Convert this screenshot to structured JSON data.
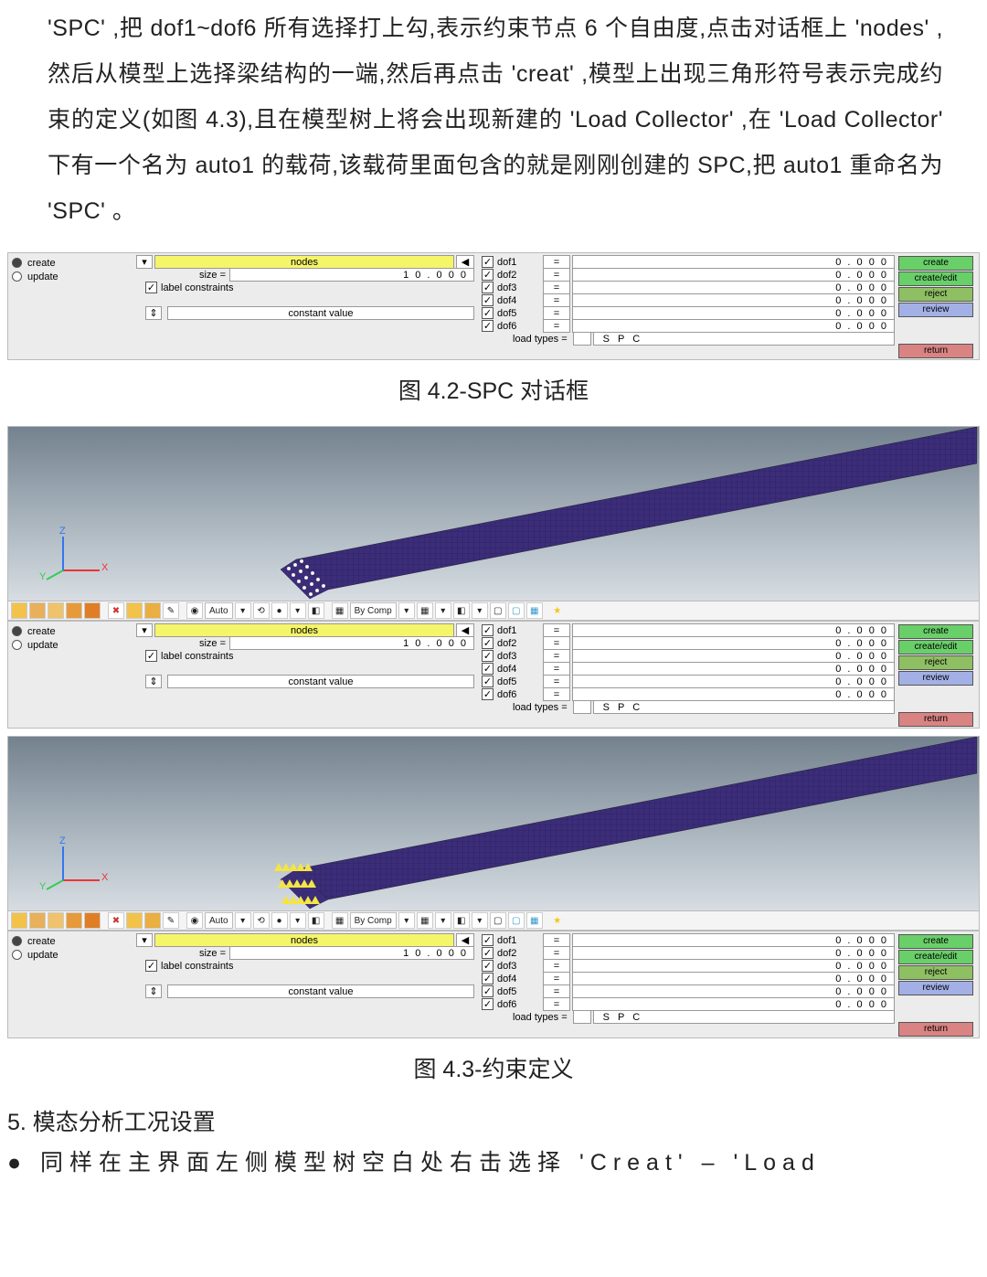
{
  "body_paragraph": "'SPC' ,把 dof1~dof6 所有选择打上勾,表示约束节点 6 个自由度,点击对话框上 'nodes' ,然后从模型上选择梁结构的一端,然后再点击 'creat' ,模型上出现三角形符号表示完成约束的定义(如图 4.3),且在模型树上将会出现新建的 'Load Collector' ,在 'Load Collector' 下有一个名为 auto1 的载荷,该载荷里面包含的就是刚刚创建的 SPC,把 auto1 重命名为  'SPC' 。",
  "caption_4_2": "图 4.2-SPC 对话框",
  "caption_4_3": "图 4.3-约束定义",
  "heading_5": "5. 模态分析工况设置",
  "bullet_line": "● 同样在主界面左侧模型树空白处右击选择 'Creat' – 'Load",
  "panel": {
    "radio_create": "create",
    "radio_update": "update",
    "nodes_label": "nodes",
    "size_label": "size =",
    "size_value": "1 0 . 0 0 0",
    "label_constraints": "label constraints",
    "constant_value": "constant value",
    "dof_labels": [
      "dof1",
      "dof2",
      "dof3",
      "dof4",
      "dof5",
      "dof6"
    ],
    "eq": "=",
    "dof_value": "0 . 0 0 0",
    "load_types_label": "load types =",
    "load_types_value": "S P C",
    "btn_create": "create",
    "btn_create_edit": "create/edit",
    "btn_reject": "reject",
    "btn_review": "review",
    "btn_return": "return"
  },
  "toolbar": {
    "auto": "Auto",
    "bycomp": "By Comp"
  },
  "triad": {
    "x": "X",
    "y": "Y",
    "z": "Z"
  },
  "icons": {
    "caret_down": "▾",
    "reset": "⟲",
    "check": "✓",
    "updown": "⇕",
    "star": "★",
    "cube": "◧",
    "sphere": "●",
    "grid": "▦",
    "gear": "✿",
    "cross": "✖",
    "paint": "✎",
    "eye": "◉",
    "box": "▢",
    "tri_left": "◀"
  }
}
